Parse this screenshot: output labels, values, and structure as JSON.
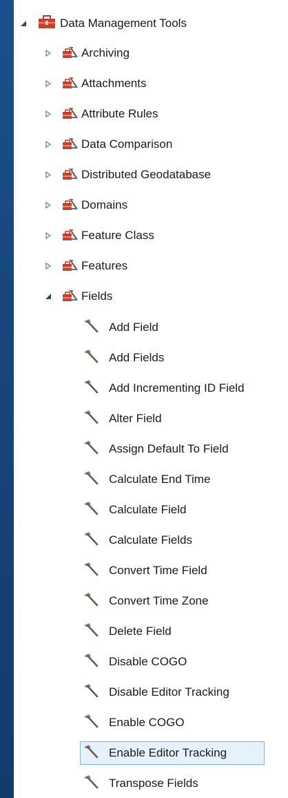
{
  "colors": {
    "background_top": "#1d4f8c",
    "panel": "#ffffff",
    "toolbox_red": "#c0392b",
    "selection_fill": "#e5f1fb",
    "selection_border": "#7eb4ea"
  },
  "tree": {
    "root": {
      "label": "Data Management Tools",
      "icon": "toolbox-icon",
      "expanded": true
    },
    "toolsets": [
      {
        "label": "Archiving",
        "expanded": false
      },
      {
        "label": "Attachments",
        "expanded": false
      },
      {
        "label": "Attribute Rules",
        "expanded": false
      },
      {
        "label": "Data Comparison",
        "expanded": false
      },
      {
        "label": "Distributed Geodatabase",
        "expanded": false
      },
      {
        "label": "Domains",
        "expanded": false
      },
      {
        "label": "Feature Class",
        "expanded": false
      },
      {
        "label": "Features",
        "expanded": false
      },
      {
        "label": "Fields",
        "expanded": true
      }
    ],
    "tools": [
      {
        "label": "Add Field",
        "selected": false
      },
      {
        "label": "Add Fields",
        "selected": false
      },
      {
        "label": "Add Incrementing ID Field",
        "selected": false
      },
      {
        "label": "Alter Field",
        "selected": false
      },
      {
        "label": "Assign Default To Field",
        "selected": false
      },
      {
        "label": "Calculate End Time",
        "selected": false
      },
      {
        "label": "Calculate Field",
        "selected": false
      },
      {
        "label": "Calculate Fields",
        "selected": false
      },
      {
        "label": "Convert Time Field",
        "selected": false
      },
      {
        "label": "Convert Time Zone",
        "selected": false
      },
      {
        "label": "Delete Field",
        "selected": false
      },
      {
        "label": "Disable COGO",
        "selected": false
      },
      {
        "label": "Disable Editor Tracking",
        "selected": false
      },
      {
        "label": "Enable COGO",
        "selected": false
      },
      {
        "label": "Enable Editor Tracking",
        "selected": true
      },
      {
        "label": "Transpose Fields",
        "selected": false
      }
    ]
  }
}
